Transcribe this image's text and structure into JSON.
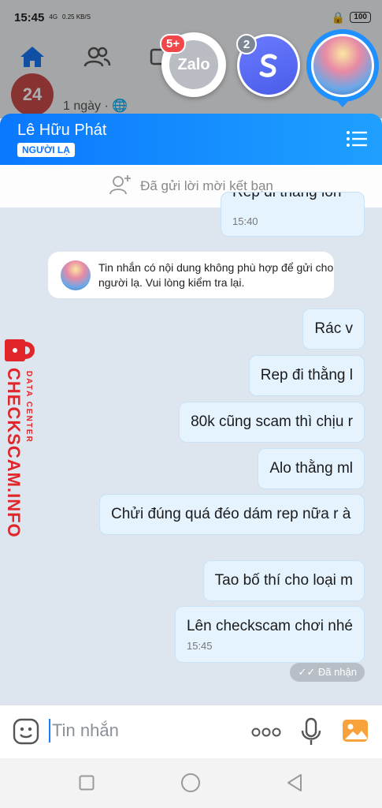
{
  "status_bar": {
    "time": "15:45",
    "network": "4G",
    "speed": "0.25\nKB/S",
    "battery": "100"
  },
  "fb_background": {
    "post_avatar_text": "24",
    "post_meta": "1 ngày · 🌐"
  },
  "chat_heads": {
    "zalo_label": "Zalo",
    "zalo_badge": "5+",
    "s_badge": "2"
  },
  "chat": {
    "name": "Lê Hữu Phát",
    "stranger_tag": "NGƯỜI LẠ",
    "friend_request": "Đã gửi lời mời kết bạn",
    "system_note": "Tin nhắn có nội dung không phù hợp để gửi cho người lạ. Vui lòng kiểm tra lại.",
    "messages": [
      {
        "text": "Rep đi thằng lồn",
        "time": "15:40"
      },
      {
        "text": "Rác v",
        "time": ""
      },
      {
        "text": "Rep đi thằng l",
        "time": ""
      },
      {
        "text": "80k cũng scam thì chịu r",
        "time": ""
      },
      {
        "text": "Alo thằng ml",
        "time": ""
      },
      {
        "text": "Chửi đúng quá đéo dám rep nữa r à",
        "time": ""
      },
      {
        "text": "Tao bố thí cho loại m",
        "time": ""
      },
      {
        "text": "Lên checkscam chơi nhé",
        "time": "15:45"
      }
    ],
    "received_status": "Đã nhận",
    "input_placeholder": "Tin nhắn"
  },
  "watermark": {
    "big": "CHECKSCAM.INFO",
    "small": "DATA CENTER"
  },
  "colors": {
    "accent": "#0a78ff",
    "bubble": "#e5f3ff",
    "watermark": "#e0262b"
  }
}
